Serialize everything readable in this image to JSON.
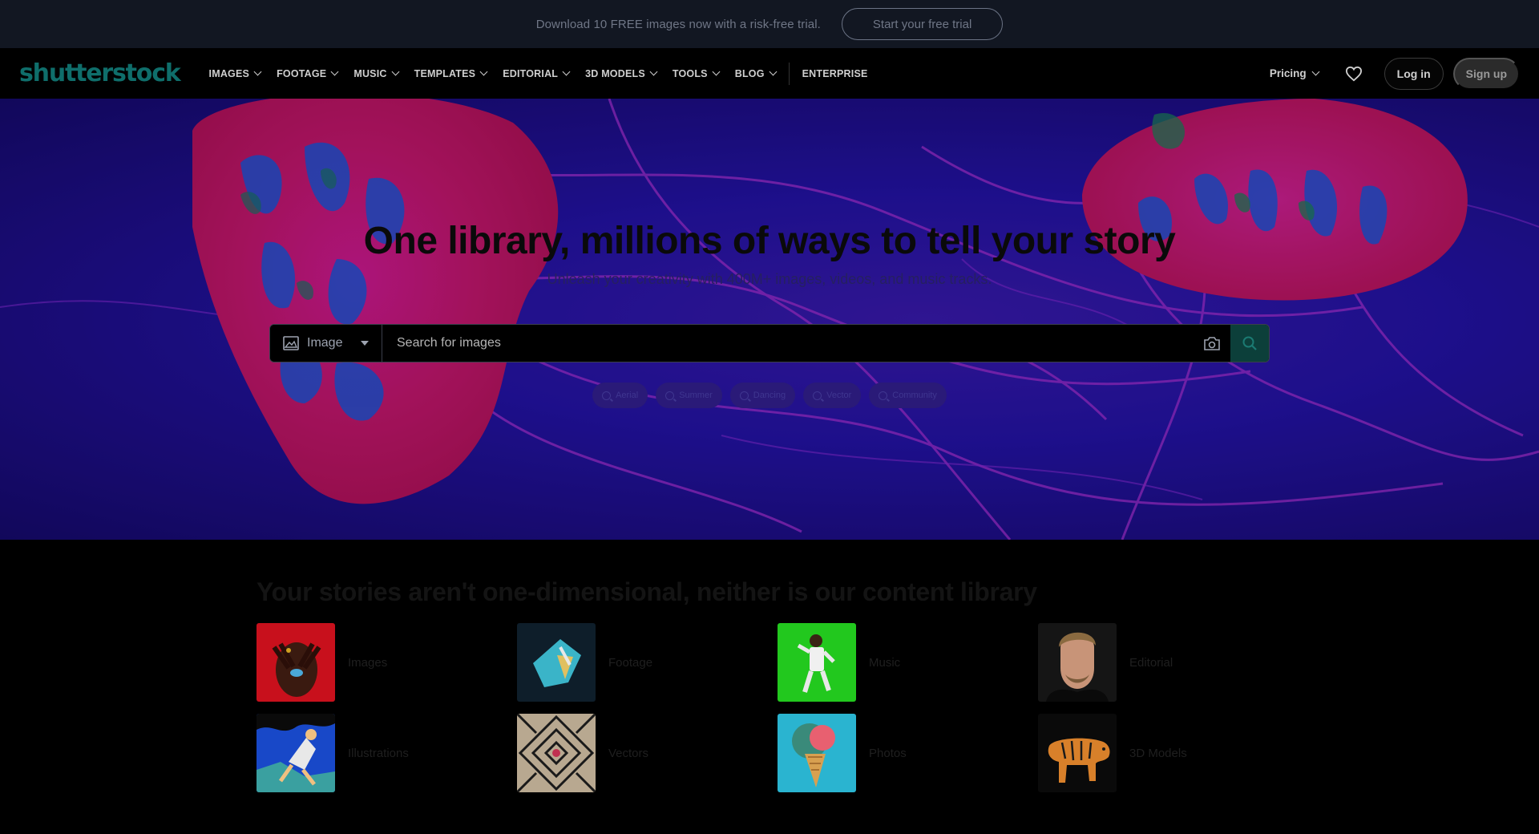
{
  "promo": {
    "text": "Download 10 FREE images now with a risk-free trial.",
    "button": "Start your free trial"
  },
  "nav": {
    "logo": "shutterstock",
    "items": [
      {
        "label": "IMAGES"
      },
      {
        "label": "FOOTAGE"
      },
      {
        "label": "MUSIC"
      },
      {
        "label": "TEMPLATES"
      },
      {
        "label": "EDITORIAL"
      },
      {
        "label": "3D MODELS"
      },
      {
        "label": "TOOLS"
      },
      {
        "label": "BLOG"
      }
    ],
    "enterprise": "ENTERPRISE",
    "pricing": "Pricing",
    "login": "Log in",
    "signup": "Sign up",
    "heart_icon": "heart-icon"
  },
  "hero": {
    "title": "One library, millions of ways to tell your story",
    "subtitle": "Unleash your creativity with 400M+ images, videos, and music tracks.",
    "search": {
      "type": "Image",
      "placeholder": "Search for images"
    },
    "chips": [
      "Aerial",
      "Summer",
      "Dancing",
      "Vector",
      "Community"
    ]
  },
  "library": {
    "title": "Your stories aren't one-dimensional, neither is our content library",
    "categories": [
      {
        "label": "Images"
      },
      {
        "label": "Footage"
      },
      {
        "label": "Music"
      },
      {
        "label": "Editorial"
      },
      {
        "label": "Illustrations"
      },
      {
        "label": "Vectors"
      },
      {
        "label": "Photos"
      },
      {
        "label": "3D Models"
      }
    ]
  },
  "colors": {
    "brand": "#0f6e6b",
    "promo_bg": "#121722",
    "hero_bg": "#2212a0",
    "search_button": "#0c3f3a"
  }
}
